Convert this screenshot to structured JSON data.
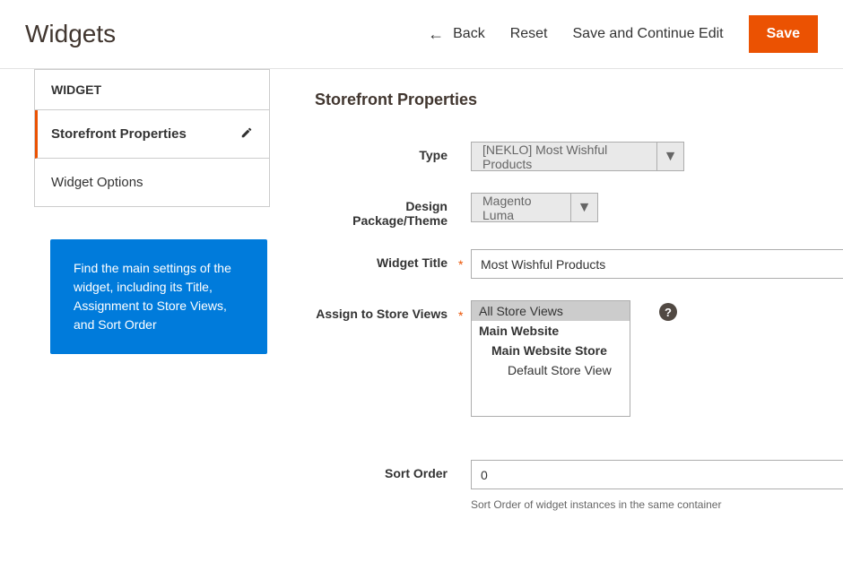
{
  "header": {
    "title": "Widgets",
    "back_label": "Back",
    "reset_label": "Reset",
    "save_continue_label": "Save and Continue Edit",
    "save_label": "Save"
  },
  "sidebar": {
    "widget_label": "WIDGET",
    "tabs": [
      {
        "label": "Storefront Properties",
        "active": true
      },
      {
        "label": "Widget Options",
        "active": false
      }
    ],
    "info_text": "Find the main settings of the widget, including its Title, Assignment to Store Views, and Sort Order"
  },
  "form": {
    "section_title": "Storefront Properties",
    "type": {
      "label": "Type",
      "value": "[NEKLO] Most Wishful Products"
    },
    "theme": {
      "label": "Design Package/Theme",
      "value": "Magento Luma"
    },
    "title": {
      "label": "Widget Title",
      "value": "Most Wishful Products"
    },
    "store_views": {
      "label": "Assign to Store Views",
      "options": [
        {
          "label": "All Store Views",
          "selected": true,
          "indent": 0
        },
        {
          "label": "Main Website",
          "selected": false,
          "indent": 1
        },
        {
          "label": "Main Website Store",
          "selected": false,
          "indent": 2
        },
        {
          "label": "Default Store View",
          "selected": false,
          "indent": 3
        }
      ]
    },
    "sort_order": {
      "label": "Sort Order",
      "value": "0",
      "helper": "Sort Order of widget instances in the same container"
    }
  }
}
